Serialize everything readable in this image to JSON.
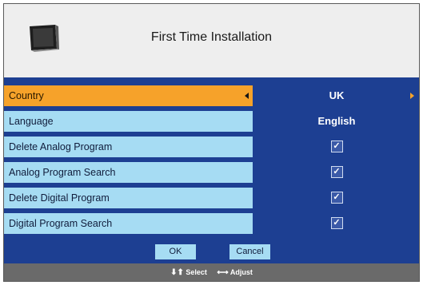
{
  "header": {
    "title": "First Time Installation",
    "icon": "tv-icon"
  },
  "rows": [
    {
      "label": "Country",
      "value": "UK",
      "selected": true
    },
    {
      "label": "Language",
      "value": "English"
    },
    {
      "label": "Delete Analog Program",
      "value": "✓"
    },
    {
      "label": "Analog Program Search",
      "value": "✓"
    },
    {
      "label": "Delete Digital Program",
      "value": "✓"
    },
    {
      "label": "Digital Program Search",
      "value": "✓"
    }
  ],
  "buttons": {
    "ok": "OK",
    "cancel": "Cancel"
  },
  "footer": {
    "select_arrows": "⬇⬆",
    "select_label": "Select",
    "adjust_arrows": "⟷",
    "adjust_label": "Adjust"
  },
  "colors": {
    "accent": "#f6a22a",
    "panel": "#1d3f92",
    "label_bg": "#a6dcf3"
  }
}
